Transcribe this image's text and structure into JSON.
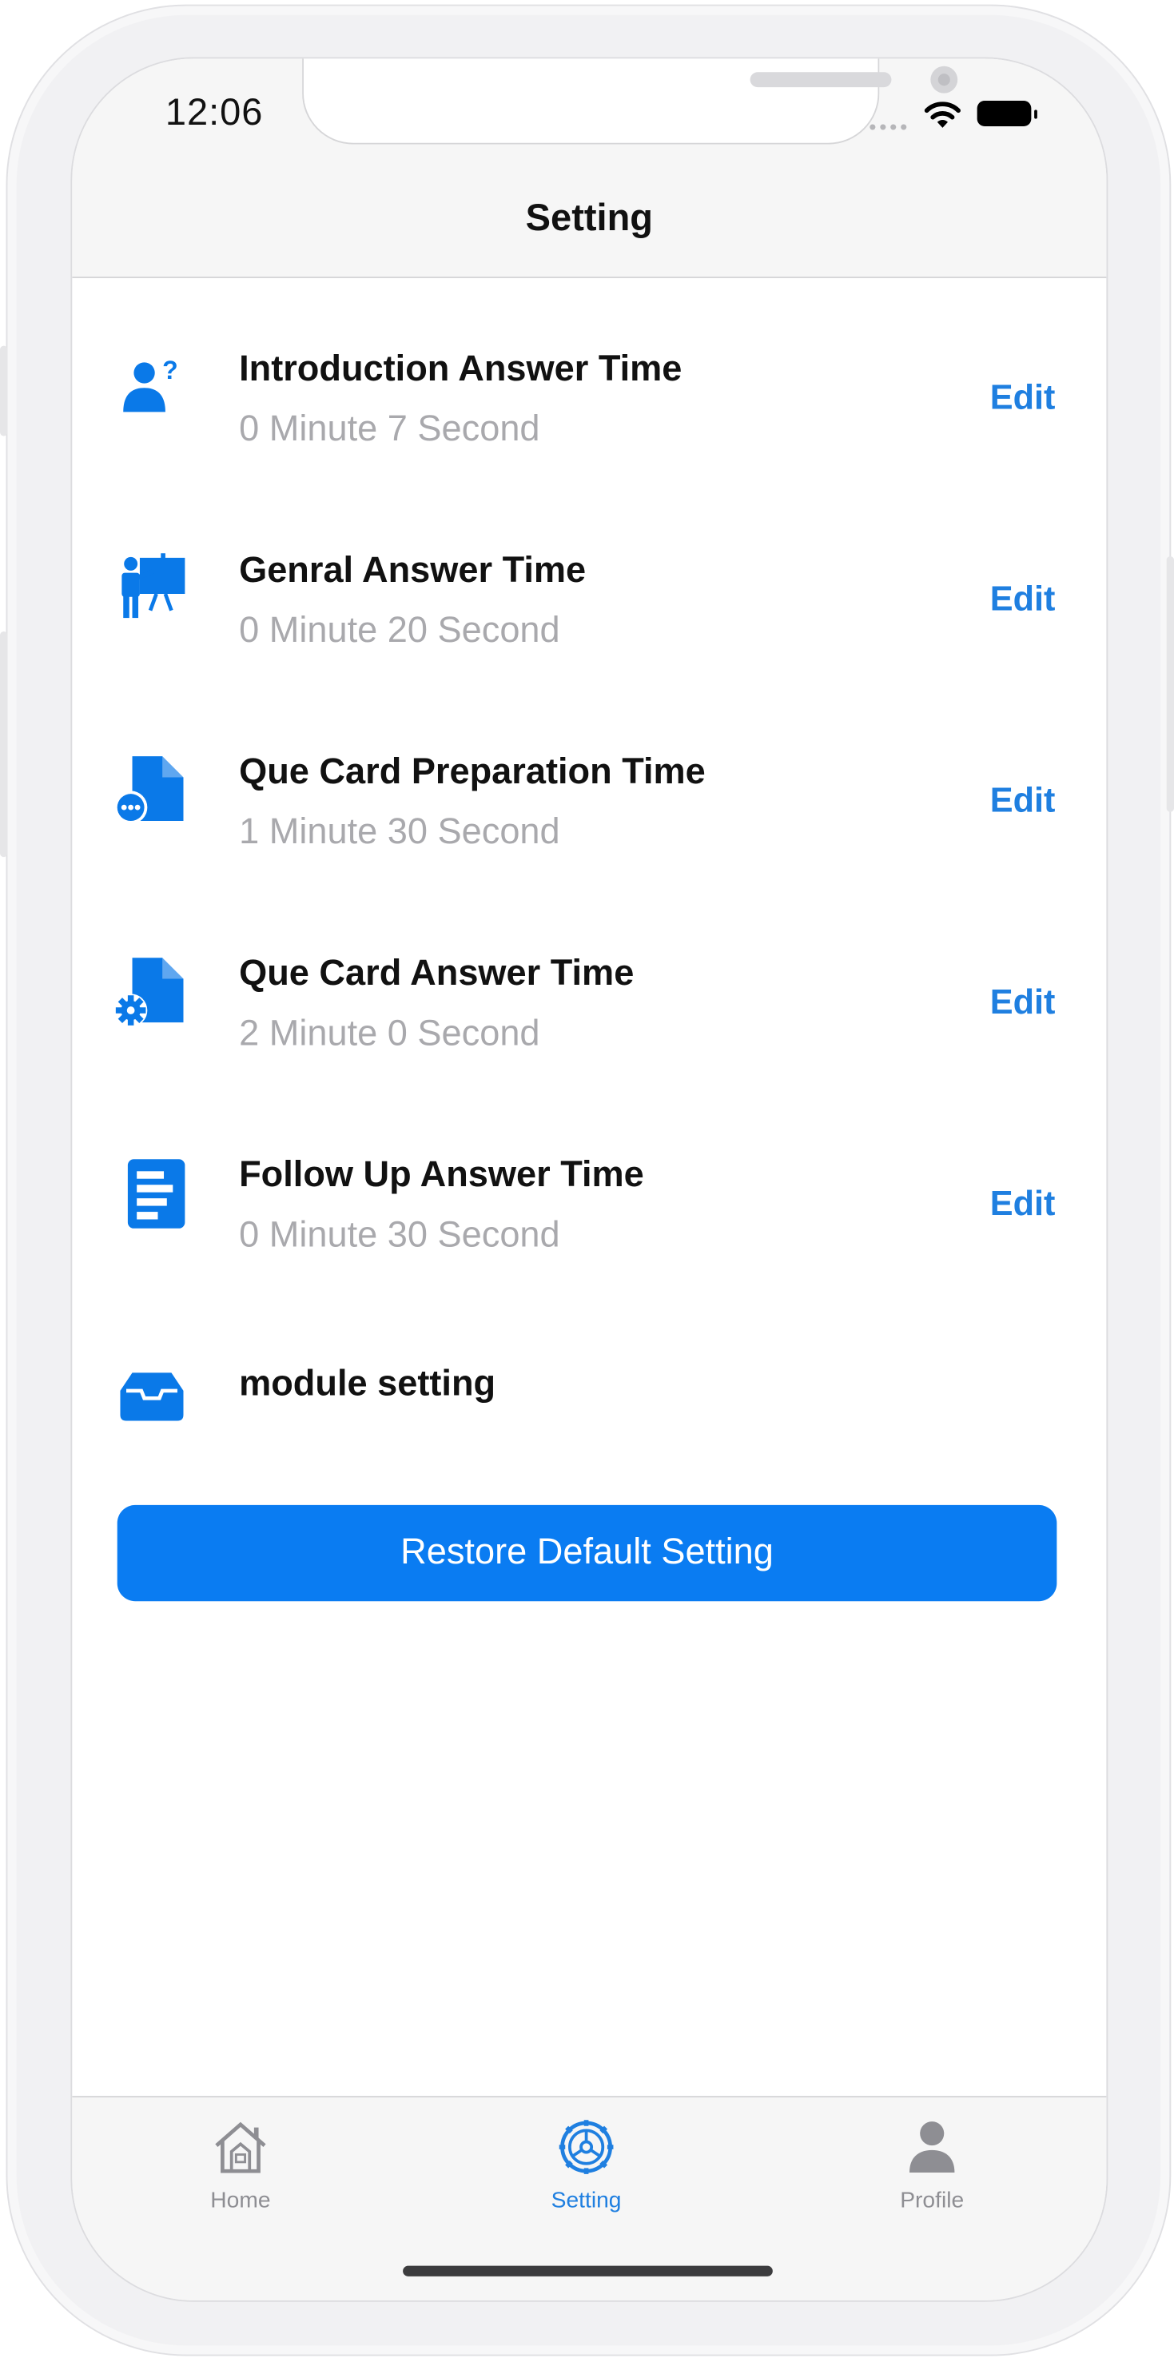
{
  "status_bar": {
    "time": "12:06"
  },
  "nav": {
    "title": "Setting"
  },
  "settings": [
    {
      "icon": "person-question-icon",
      "title": "Introduction Answer Time",
      "value": "0 Minute 7 Second",
      "action": "Edit"
    },
    {
      "icon": "presenter-board-icon",
      "title": "Genral Answer Time",
      "value": "0 Minute 20 Second",
      "action": "Edit"
    },
    {
      "icon": "document-more-icon",
      "title": "Que Card Preparation Time",
      "value": "1 Minute 30 Second",
      "action": "Edit"
    },
    {
      "icon": "document-gear-icon",
      "title": "Que Card Answer Time",
      "value": "2 Minute 0 Second",
      "action": "Edit"
    },
    {
      "icon": "document-list-icon",
      "title": "Follow Up Answer Time",
      "value": "0 Minute 30 Second",
      "action": "Edit"
    }
  ],
  "module_setting": {
    "icon": "tray-icon",
    "label": "module setting"
  },
  "restore_button": {
    "label": "Restore Default Setting"
  },
  "tabbar": {
    "tabs": [
      {
        "icon": "home-icon",
        "label": "Home",
        "active": false
      },
      {
        "icon": "steering-wheel-icon",
        "label": "Setting",
        "active": true
      },
      {
        "icon": "person-icon",
        "label": "Profile",
        "active": false
      }
    ]
  },
  "colors": {
    "accent": "#0A7CF2",
    "edit_text": "#1F7FE0",
    "subtitle": "#A9A9AD",
    "inactive_tab": "#8E8E93"
  }
}
